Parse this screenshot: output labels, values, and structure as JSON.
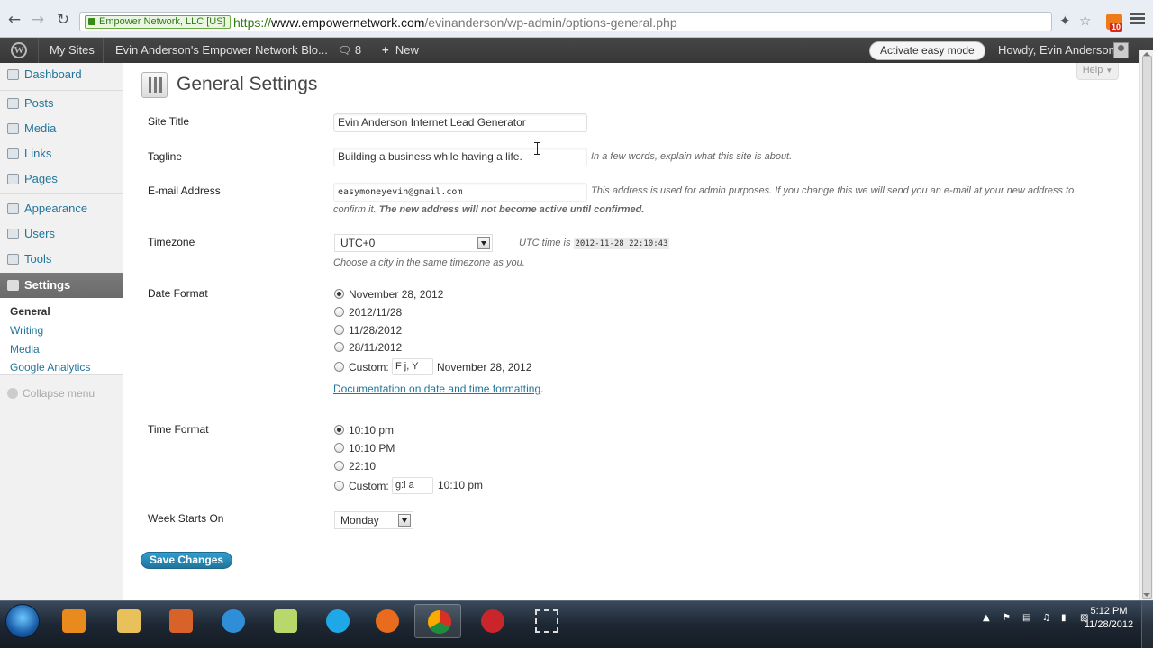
{
  "browser": {
    "ev_badge": "Empower Network, LLC [US]",
    "url_scheme": "https://",
    "url_host": "www.empowernetwork.com",
    "url_path": "/evinanderson/wp-admin/options-general.php",
    "rss_count": "10"
  },
  "adminbar": {
    "my_sites": "My Sites",
    "site_name": "Evin Anderson's Empower Network Blo...",
    "comments_count": "8",
    "new_label": "New",
    "easy_mode": "Activate easy mode",
    "howdy": "Howdy, Evin Anderson"
  },
  "sidebar": {
    "items": [
      {
        "label": "Dashboard"
      },
      {
        "label": "Posts"
      },
      {
        "label": "Media"
      },
      {
        "label": "Links"
      },
      {
        "label": "Pages"
      },
      {
        "label": "Appearance"
      },
      {
        "label": "Users"
      },
      {
        "label": "Tools"
      },
      {
        "label": "Settings"
      }
    ],
    "submenu": [
      "General",
      "Writing",
      "Media",
      "Google Analytics"
    ],
    "collapse": "Collapse menu"
  },
  "main": {
    "help": "Help",
    "title": "General Settings",
    "site_title_label": "Site Title",
    "site_title_value": "Evin Anderson Internet Lead Generator",
    "tagline_label": "Tagline",
    "tagline_value": "Building a business while having a life.",
    "tagline_desc": "In a few words, explain what this site is about.",
    "email_label": "E-mail Address",
    "email_value": "easymoneyevin@gmail.com",
    "email_desc_1": "This address is used for admin purposes. If you change this we will send you an e-mail at your new address to",
    "email_desc_2a": "confirm it.",
    "email_desc_2b": "The new address will not become active until confirmed.",
    "timezone_label": "Timezone",
    "timezone_value": "UTC+0",
    "utc_prefix": "UTC time is",
    "utc_time": "2012-11-28 22:10:43",
    "timezone_desc": "Choose a city in the same timezone as you.",
    "date_format_label": "Date Format",
    "date_options": [
      "November 28, 2012",
      "2012/11/28",
      "11/28/2012",
      "28/11/2012"
    ],
    "date_selected": 0,
    "custom_label": "Custom:",
    "date_custom_value": "F j, Y",
    "date_custom_preview": "November 28, 2012",
    "doc_link": "Documentation on date and time formatting",
    "doc_link_end": ".",
    "time_format_label": "Time Format",
    "time_options": [
      "10:10 pm",
      "10:10 PM",
      "22:10"
    ],
    "time_selected": 0,
    "time_custom_value": "g:i a",
    "time_custom_preview": "10:10 pm",
    "week_label": "Week Starts On",
    "week_value": "Monday",
    "save": "Save Changes"
  },
  "taskbar": {
    "clock_time": "5:12 PM",
    "clock_date": "11/28/2012"
  }
}
